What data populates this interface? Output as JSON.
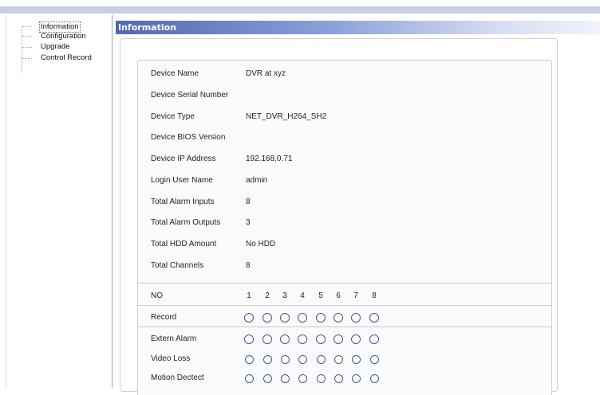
{
  "tree": {
    "items": [
      {
        "label": "Information",
        "selected": true
      },
      {
        "label": "Configuration",
        "selected": false
      },
      {
        "label": "Upgrade",
        "selected": false
      },
      {
        "label": "Control Record",
        "selected": false
      }
    ]
  },
  "panel": {
    "title": "Information"
  },
  "info": {
    "device_name_label": "Device Name",
    "device_name_value": "DVR at xyz",
    "device_serial_label": "Device Serial Number",
    "device_serial_value": "",
    "device_type_label": "Device Type",
    "device_type_value": "NET_DVR_H264_SH2",
    "bios_label": "Device BIOS Version",
    "bios_value": "",
    "ip_label": "Device IP Address",
    "ip_value": "192.168.0.71",
    "login_label": "Login User Name",
    "login_value": "admin",
    "alarm_in_label": "Total Alarm Inputs",
    "alarm_in_value": "8",
    "alarm_out_label": "Total Alarm Outputs",
    "alarm_out_value": "3",
    "hdd_label": "Total HDD Amount",
    "hdd_value": "No HDD",
    "channels_label": "Total Channels",
    "channels_value": "8"
  },
  "status": {
    "no_label": "NO",
    "channels": [
      "1",
      "2",
      "3",
      "4",
      "5",
      "6",
      "7",
      "8"
    ],
    "record_label": "Record",
    "extern_alarm_label": "Extern Alarm",
    "video_loss_label": "Video Loss",
    "motion_label": "Motion Dectect"
  },
  "colors": {
    "title_bar_start": "#4f69b1",
    "radio_border": "#3c5a8a"
  }
}
